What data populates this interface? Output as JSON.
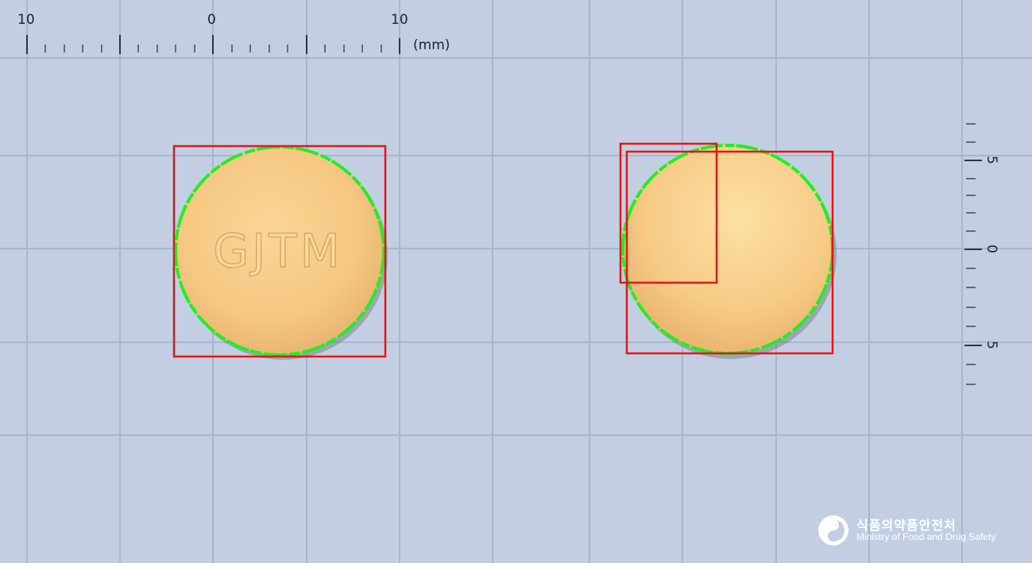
{
  "ruler_top": {
    "labels": [
      "10",
      "0",
      "10"
    ],
    "unit": "(mm)"
  },
  "ruler_right": {
    "labels": [
      "5",
      "0",
      "5"
    ]
  },
  "tablet_front": {
    "imprint": "GJTM",
    "color": "#f5c882"
  },
  "tablet_back": {
    "imprint": "",
    "color": "#f6cb86"
  },
  "colors": {
    "background": "#c2cfe2",
    "grid": "#a7b6cc",
    "detection_box": "#e01818",
    "contour": "#22ee22"
  },
  "logo": {
    "korean": "식품의약품안전처",
    "english": "Ministry of Food and Drug Safety"
  }
}
